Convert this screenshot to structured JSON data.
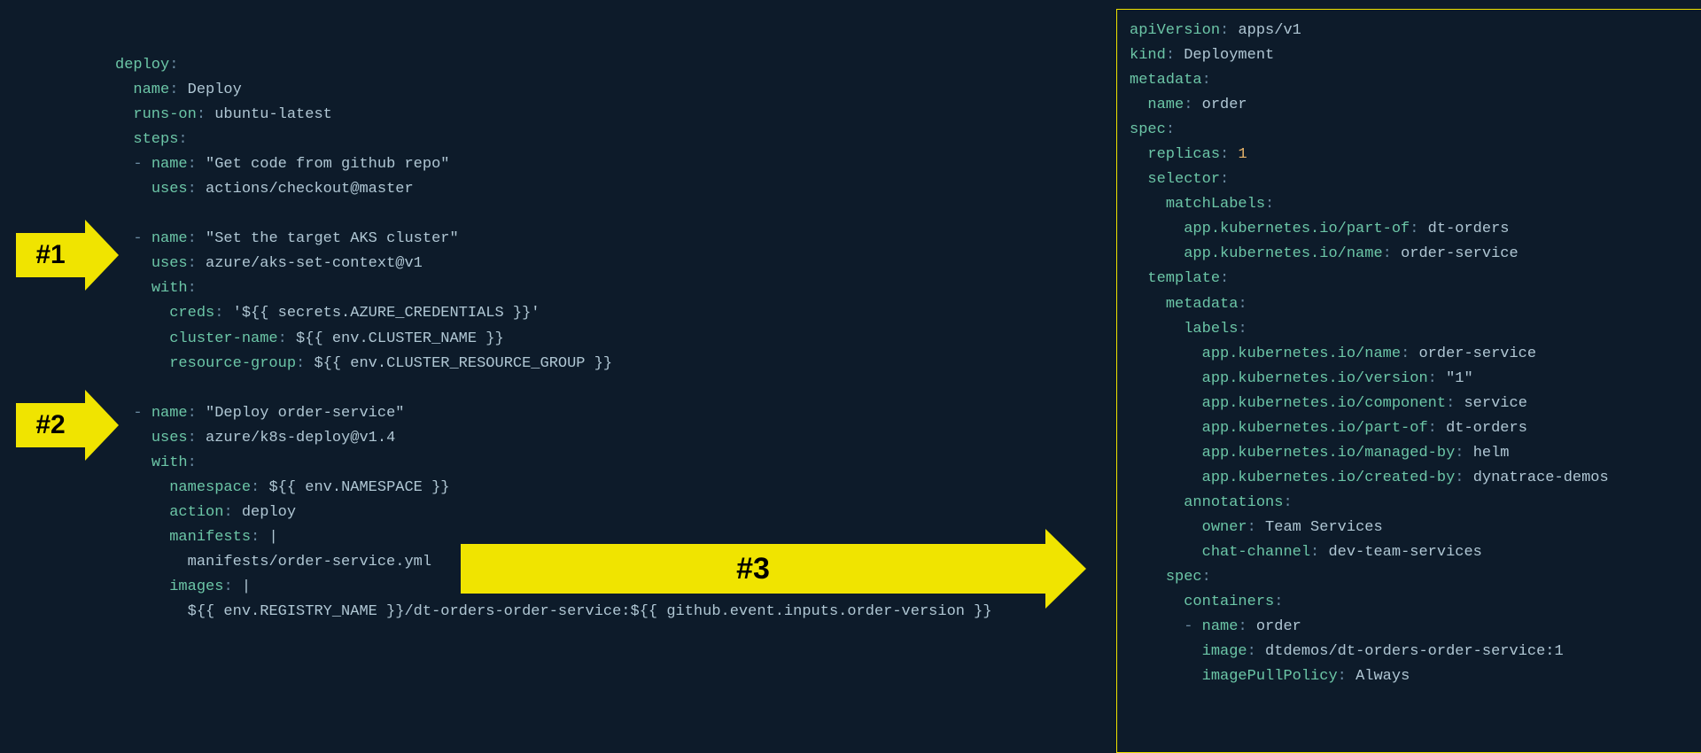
{
  "arrows": {
    "a1": "#1",
    "a2": "#2",
    "a3": "#3"
  },
  "left": [
    {
      "indent": 0,
      "segs": [
        [
          "key",
          "deploy"
        ],
        [
          "punc",
          ":"
        ]
      ]
    },
    {
      "indent": 1,
      "segs": [
        [
          "key",
          "name"
        ],
        [
          "punc",
          ": "
        ],
        [
          "str",
          "Deploy"
        ]
      ]
    },
    {
      "indent": 1,
      "segs": [
        [
          "key",
          "runs-on"
        ],
        [
          "punc",
          ": "
        ],
        [
          "str",
          "ubuntu-latest"
        ]
      ]
    },
    {
      "indent": 1,
      "segs": [
        [
          "key",
          "steps"
        ],
        [
          "punc",
          ":"
        ]
      ]
    },
    {
      "indent": 1,
      "segs": [
        [
          "dash",
          "- "
        ],
        [
          "key",
          "name"
        ],
        [
          "punc",
          ": "
        ],
        [
          "str",
          "\"Get code from github repo\""
        ]
      ]
    },
    {
      "indent": 2,
      "segs": [
        [
          "key",
          "uses"
        ],
        [
          "punc",
          ": "
        ],
        [
          "str",
          "actions/checkout@master"
        ]
      ]
    },
    {
      "blank": true
    },
    {
      "indent": 1,
      "segs": [
        [
          "dash",
          "- "
        ],
        [
          "key",
          "name"
        ],
        [
          "punc",
          ": "
        ],
        [
          "str",
          "\"Set the target AKS cluster\""
        ]
      ]
    },
    {
      "indent": 2,
      "segs": [
        [
          "key",
          "uses"
        ],
        [
          "punc",
          ": "
        ],
        [
          "str",
          "azure/aks-set-context@v1"
        ]
      ]
    },
    {
      "indent": 2,
      "segs": [
        [
          "key",
          "with"
        ],
        [
          "punc",
          ":"
        ]
      ]
    },
    {
      "indent": 3,
      "segs": [
        [
          "key",
          "creds"
        ],
        [
          "punc",
          ": "
        ],
        [
          "str",
          "'${{ secrets.AZURE_CREDENTIALS }}'"
        ]
      ]
    },
    {
      "indent": 3,
      "segs": [
        [
          "key",
          "cluster-name"
        ],
        [
          "punc",
          ": "
        ],
        [
          "expr",
          "${{ env.CLUSTER_NAME }}"
        ]
      ]
    },
    {
      "indent": 3,
      "segs": [
        [
          "key",
          "resource-group"
        ],
        [
          "punc",
          ": "
        ],
        [
          "expr",
          "${{ env.CLUSTER_RESOURCE_GROUP }}"
        ]
      ]
    },
    {
      "blank": true
    },
    {
      "indent": 1,
      "segs": [
        [
          "dash",
          "- "
        ],
        [
          "key",
          "name"
        ],
        [
          "punc",
          ": "
        ],
        [
          "str",
          "\"Deploy order-service\""
        ]
      ]
    },
    {
      "indent": 2,
      "segs": [
        [
          "key",
          "uses"
        ],
        [
          "punc",
          ": "
        ],
        [
          "str",
          "azure/k8s-deploy@v1.4"
        ]
      ]
    },
    {
      "indent": 2,
      "segs": [
        [
          "key",
          "with"
        ],
        [
          "punc",
          ":"
        ]
      ]
    },
    {
      "indent": 3,
      "segs": [
        [
          "key",
          "namespace"
        ],
        [
          "punc",
          ": "
        ],
        [
          "expr",
          "${{ env.NAMESPACE }}"
        ]
      ]
    },
    {
      "indent": 3,
      "segs": [
        [
          "key",
          "action"
        ],
        [
          "punc",
          ": "
        ],
        [
          "str",
          "deploy"
        ]
      ]
    },
    {
      "indent": 3,
      "segs": [
        [
          "key",
          "manifests"
        ],
        [
          "punc",
          ": "
        ],
        [
          "str",
          "|"
        ]
      ]
    },
    {
      "indent": 4,
      "segs": [
        [
          "str",
          "manifests/order-service.yml"
        ]
      ]
    },
    {
      "indent": 3,
      "segs": [
        [
          "key",
          "images"
        ],
        [
          "punc",
          ": "
        ],
        [
          "str",
          "|"
        ]
      ]
    },
    {
      "indent": 4,
      "segs": [
        [
          "expr",
          "${{ env.REGISTRY_NAME }}/dt-orders-order-service:${{ github.event.inputs.order-version }}"
        ]
      ]
    }
  ],
  "right": [
    {
      "indent": 0,
      "segs": [
        [
          "key",
          "apiVersion"
        ],
        [
          "punc",
          ": "
        ],
        [
          "str",
          "apps/v1"
        ]
      ]
    },
    {
      "indent": 0,
      "segs": [
        [
          "key",
          "kind"
        ],
        [
          "punc",
          ": "
        ],
        [
          "str",
          "Deployment"
        ]
      ]
    },
    {
      "indent": 0,
      "segs": [
        [
          "key",
          "metadata"
        ],
        [
          "punc",
          ":"
        ]
      ]
    },
    {
      "indent": 1,
      "segs": [
        [
          "key",
          "name"
        ],
        [
          "punc",
          ": "
        ],
        [
          "str",
          "order"
        ]
      ]
    },
    {
      "indent": 0,
      "segs": [
        [
          "key",
          "spec"
        ],
        [
          "punc",
          ":"
        ]
      ]
    },
    {
      "indent": 1,
      "segs": [
        [
          "key",
          "replicas"
        ],
        [
          "punc",
          ": "
        ],
        [
          "num",
          "1"
        ]
      ]
    },
    {
      "indent": 1,
      "segs": [
        [
          "key",
          "selector"
        ],
        [
          "punc",
          ":"
        ]
      ]
    },
    {
      "indent": 2,
      "segs": [
        [
          "key",
          "matchLabels"
        ],
        [
          "punc",
          ":"
        ]
      ]
    },
    {
      "indent": 3,
      "segs": [
        [
          "key",
          "app.kubernetes.io/part-of"
        ],
        [
          "punc",
          ": "
        ],
        [
          "str",
          "dt-orders"
        ]
      ]
    },
    {
      "indent": 3,
      "segs": [
        [
          "key",
          "app.kubernetes.io/name"
        ],
        [
          "punc",
          ": "
        ],
        [
          "str",
          "order-service"
        ]
      ]
    },
    {
      "indent": 1,
      "segs": [
        [
          "key",
          "template"
        ],
        [
          "punc",
          ":"
        ]
      ]
    },
    {
      "indent": 2,
      "segs": [
        [
          "key",
          "metadata"
        ],
        [
          "punc",
          ":"
        ]
      ]
    },
    {
      "indent": 3,
      "segs": [
        [
          "key",
          "labels"
        ],
        [
          "punc",
          ":"
        ]
      ]
    },
    {
      "indent": 4,
      "segs": [
        [
          "key",
          "app.kubernetes.io/name"
        ],
        [
          "punc",
          ": "
        ],
        [
          "str",
          "order-service"
        ]
      ]
    },
    {
      "indent": 4,
      "segs": [
        [
          "key",
          "app.kubernetes.io/version"
        ],
        [
          "punc",
          ": "
        ],
        [
          "str",
          "\"1\""
        ]
      ]
    },
    {
      "indent": 4,
      "segs": [
        [
          "key",
          "app.kubernetes.io/component"
        ],
        [
          "punc",
          ": "
        ],
        [
          "str",
          "service"
        ]
      ]
    },
    {
      "indent": 4,
      "segs": [
        [
          "key",
          "app.kubernetes.io/part-of"
        ],
        [
          "punc",
          ": "
        ],
        [
          "str",
          "dt-orders"
        ]
      ]
    },
    {
      "indent": 4,
      "segs": [
        [
          "key",
          "app.kubernetes.io/managed-by"
        ],
        [
          "punc",
          ": "
        ],
        [
          "str",
          "helm"
        ]
      ]
    },
    {
      "indent": 4,
      "segs": [
        [
          "key",
          "app.kubernetes.io/created-by"
        ],
        [
          "punc",
          ": "
        ],
        [
          "str",
          "dynatrace-demos"
        ]
      ]
    },
    {
      "indent": 3,
      "segs": [
        [
          "key",
          "annotations"
        ],
        [
          "punc",
          ":"
        ]
      ]
    },
    {
      "indent": 4,
      "segs": [
        [
          "key",
          "owner"
        ],
        [
          "punc",
          ": "
        ],
        [
          "str",
          "Team Services"
        ]
      ]
    },
    {
      "indent": 4,
      "segs": [
        [
          "key",
          "chat-channel"
        ],
        [
          "punc",
          ": "
        ],
        [
          "str",
          "dev-team-services"
        ]
      ]
    },
    {
      "indent": 2,
      "segs": [
        [
          "key",
          "spec"
        ],
        [
          "punc",
          ":"
        ]
      ]
    },
    {
      "indent": 3,
      "segs": [
        [
          "key",
          "containers"
        ],
        [
          "punc",
          ":"
        ]
      ]
    },
    {
      "indent": 3,
      "segs": [
        [
          "dash",
          "- "
        ],
        [
          "key",
          "name"
        ],
        [
          "punc",
          ": "
        ],
        [
          "str",
          "order"
        ]
      ]
    },
    {
      "indent": 4,
      "segs": [
        [
          "key",
          "image"
        ],
        [
          "punc",
          ": "
        ],
        [
          "str",
          "dtdemos/dt-orders-order-service:1"
        ]
      ]
    },
    {
      "indent": 4,
      "segs": [
        [
          "key",
          "imagePullPolicy"
        ],
        [
          "punc",
          ": "
        ],
        [
          "str",
          "Always"
        ]
      ]
    }
  ]
}
